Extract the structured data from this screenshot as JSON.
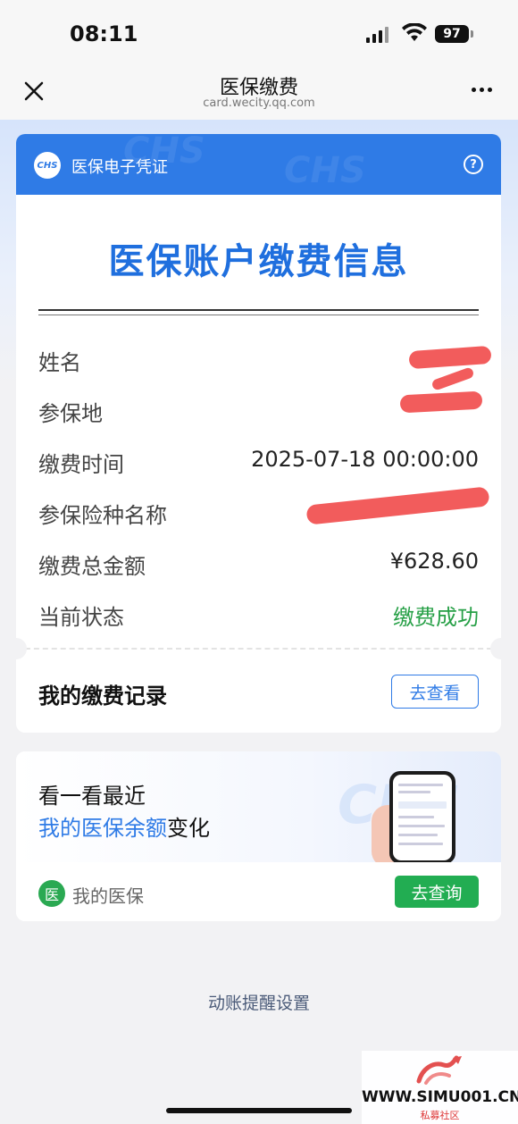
{
  "status_bar": {
    "time": "08:11",
    "battery": "97"
  },
  "nav": {
    "title": "医保缴费",
    "subtitle": "card.wecity.qq.com"
  },
  "card": {
    "header_label": "医保电子凭证",
    "logo_text": "CHS",
    "watermark_text": "CHS",
    "help_symbol": "?",
    "title": "医保账户缴费信息",
    "rows": [
      {
        "label": "姓名",
        "value": ""
      },
      {
        "label": "参保地",
        "value": ""
      },
      {
        "label": "缴费时间",
        "value": "2025-07-18 00:00:00"
      },
      {
        "label": "参保险种名称",
        "value": ""
      },
      {
        "label": "缴费总金额",
        "value": "¥628.60"
      },
      {
        "label": "当前状态",
        "value": "缴费成功"
      }
    ],
    "record_label": "我的缴费记录",
    "record_button": "去查看"
  },
  "promo": {
    "line1": "看一看最近",
    "line2_highlight": "我的医保余额",
    "line2_suffix": "变化",
    "watermark_text": "CHS",
    "badge_text": "医",
    "my_label": "我的医保",
    "query_button": "去查询"
  },
  "reminder_link": "动账提醒设置",
  "watermark": {
    "url": "WWW.SIMU001.CN",
    "sub": "私募社区"
  },
  "colors": {
    "primary": "#2f7be6",
    "success": "#27a047",
    "green_button": "#22ad52",
    "redaction": "#f25c5c"
  }
}
